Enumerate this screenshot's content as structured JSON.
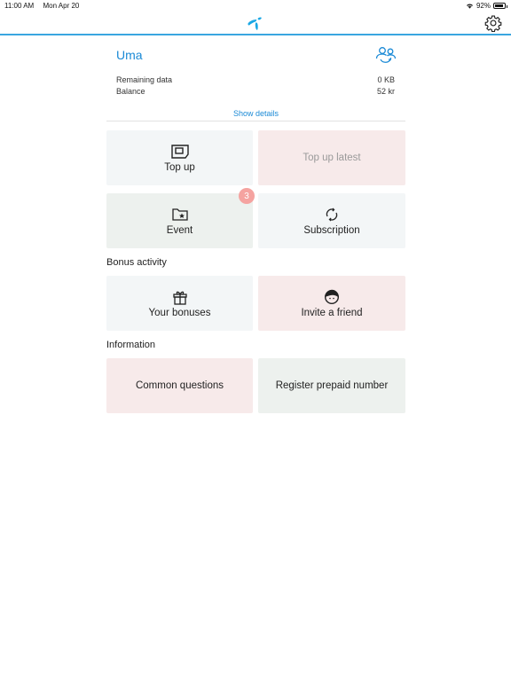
{
  "status_bar": {
    "time": "11:00 AM",
    "date": "Mon Apr 20",
    "battery_percent_label": "92%",
    "battery_level": 0.92
  },
  "nav": {
    "logo_icon": "telenor-logo-icon",
    "settings_icon": "gear-icon",
    "accent_color": "#3aa6e0"
  },
  "account": {
    "name": "Uma",
    "switch_icon": "switch-user-icon",
    "rows": [
      {
        "label": "Remaining data",
        "value": "0 KB"
      },
      {
        "label": "Balance",
        "value": "52 kr"
      }
    ],
    "show_details": "Show details"
  },
  "tiles_main": [
    {
      "label": "Top up",
      "icon": "sim-card-icon"
    },
    {
      "label": "Top up latest"
    },
    {
      "label": "Event",
      "icon": "folder-star-icon",
      "badge": "3"
    },
    {
      "label": "Subscription",
      "icon": "refresh-icon"
    }
  ],
  "bonus": {
    "title": "Bonus activity",
    "tiles": [
      {
        "label": "Your bonuses",
        "icon": "gift-icon"
      },
      {
        "label": "Invite a friend",
        "icon": "face-icon"
      }
    ]
  },
  "information": {
    "title": "Information",
    "tiles": [
      {
        "label": "Common questions"
      },
      {
        "label": "Register prepaid number"
      }
    ]
  }
}
